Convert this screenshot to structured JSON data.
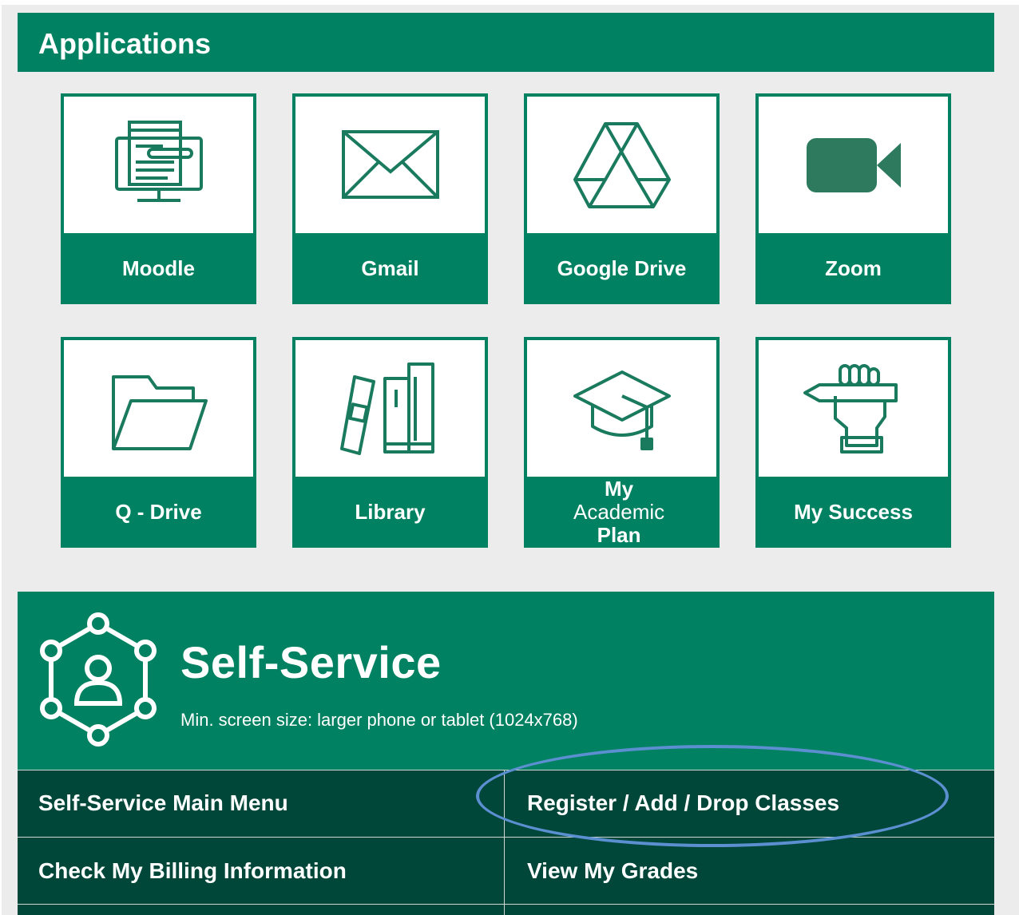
{
  "applications": {
    "header": "Applications",
    "tiles": [
      {
        "label": "Moodle",
        "icon": "moodle-computer-icon"
      },
      {
        "label": "Gmail",
        "icon": "envelope-icon"
      },
      {
        "label": "Google Drive",
        "icon": "google-drive-icon"
      },
      {
        "label": "Zoom",
        "icon": "video-camera-icon"
      },
      {
        "label": "Q - Drive",
        "icon": "folder-icon"
      },
      {
        "label": "Library",
        "icon": "books-icon"
      },
      {
        "label_lines": [
          "My",
          "Academic",
          "Plan"
        ],
        "icon": "graduation-cap-icon"
      },
      {
        "label": "My Success",
        "icon": "hand-pencil-icon"
      }
    ]
  },
  "self_service": {
    "title": "Self-Service",
    "subtitle": "Min. screen size: larger phone or tablet (1024x768)",
    "icon": "network-person-icon",
    "links": [
      "Self-Service Main Menu",
      "Register / Add / Drop Classes",
      "Check My Billing Information",
      "View My Grades"
    ]
  },
  "colors": {
    "primary_green": "#008161",
    "dark_green": "#00473a",
    "annotation_blue": "#5b8fd0"
  }
}
